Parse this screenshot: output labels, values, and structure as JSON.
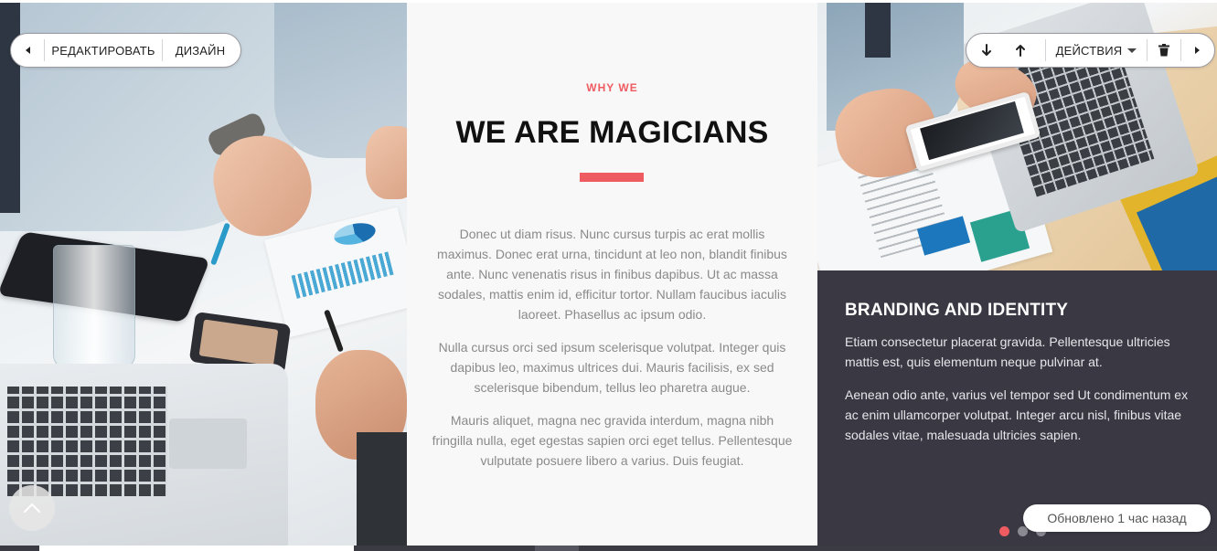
{
  "editor_toolbar_left": {
    "edit_label": "РЕДАКТИРОВАТЬ",
    "design_label": "ДИЗАЙН"
  },
  "editor_toolbar_right": {
    "actions_label": "ДЕЙСТВИЯ"
  },
  "section": {
    "eyebrow": "WHY WE",
    "title": "WE ARE MAGICIANS",
    "paragraphs": [
      "Donec ut diam risus. Nunc cursus turpis ac erat mollis maximus. Donec erat urna, tincidunt at leo non, blandit finibus ante. Nunc venenatis risus in finibus dapibus. Ut ac massa sodales, mattis enim id, efficitur tortor. Nullam faucibus iaculis laoreet. Phasellus ac ipsum odio.",
      "Nulla cursus orci sed ipsum scelerisque volutpat. Integer quis dapibus leo, maximus ultrices dui. Mauris facilisis, ex sed scelerisque bibendum, tellus leo pharetra augue.",
      "Mauris aliquet, magna nec gravida interdum, magna nibh fringilla nulla, eget egestas sapien orci eget tellus. Pellentesque vulputate posuere libero a varius. Duis feugiat."
    ],
    "accent_color": "#ee5c61"
  },
  "slider": {
    "title": "BRANDING AND IDENTITY",
    "paragraphs": [
      "Etiam consectetur placerat gravida. Pellentesque ultricies mattis est, quis elementum neque pulvinar at.",
      "Aenean odio ante, varius vel tempor sed Ut condimentum ex ac enim ullamcorper volutpat. Integer arcu nisl, finibus vitae sodales vitae, malesuada ultricies sapien."
    ],
    "active_slide": 1,
    "slide_count": 3,
    "panel_color": "#393843"
  },
  "status": {
    "updated_text": "Обновлено 1 час назад"
  },
  "icons": {
    "prev": "triangle-left-icon",
    "next": "triangle-right-icon",
    "move_down": "arrow-down-icon",
    "move_up": "arrow-up-icon",
    "delete": "trash-icon",
    "scroll_top": "chevron-up-icon"
  }
}
